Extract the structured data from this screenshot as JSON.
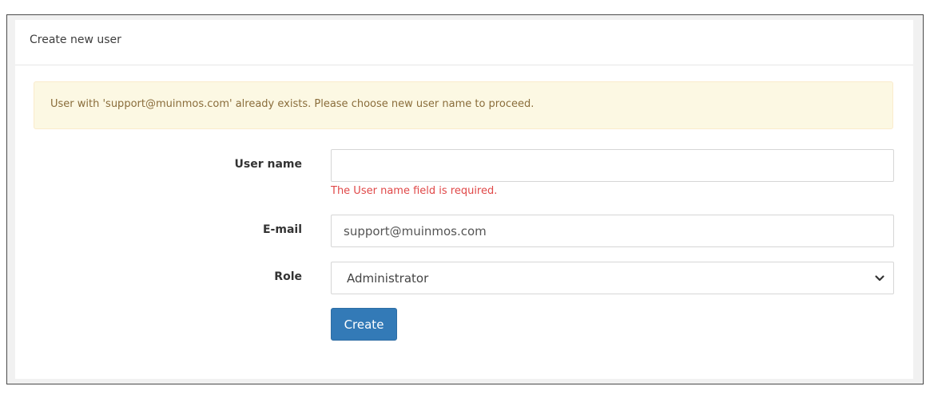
{
  "panel": {
    "title": "Create new user"
  },
  "alert": {
    "message": "User with 'support@muinmos.com' already exists. Please choose new user name to proceed.",
    "color": "#fcf8e3"
  },
  "form": {
    "username": {
      "label": "User name",
      "value": "",
      "error": "The User name field is required."
    },
    "email": {
      "label": "E-mail",
      "value": "support@muinmos.com"
    },
    "role": {
      "label": "Role",
      "selected": "Administrator",
      "icon": "chevron-down-icon"
    },
    "submit_label": "Create"
  },
  "colors": {
    "primary": "#337ab7",
    "error": "#e04848"
  }
}
